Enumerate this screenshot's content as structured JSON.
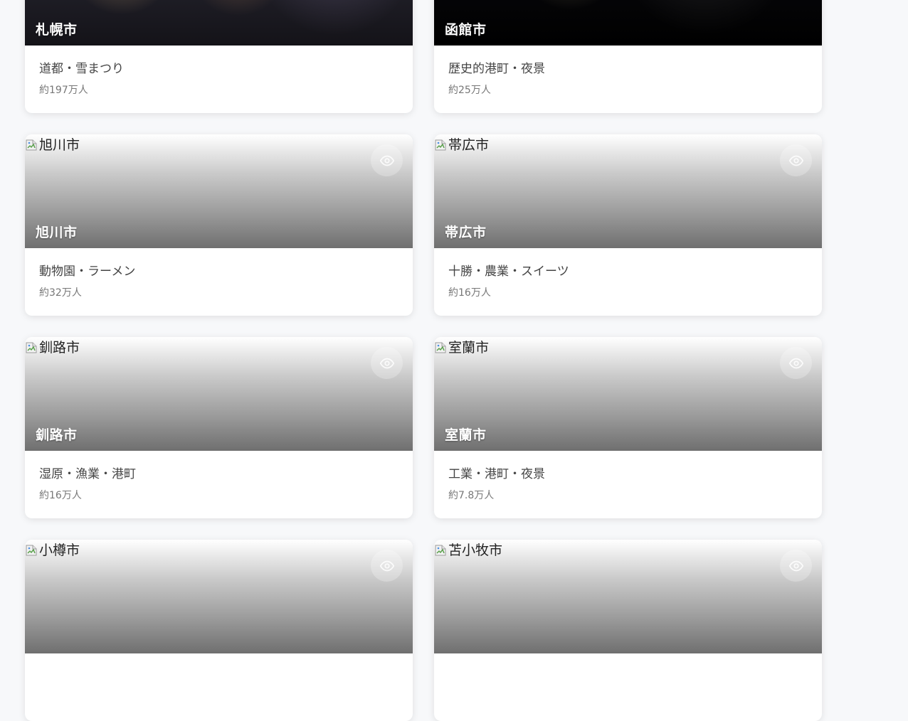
{
  "cards": [
    {
      "city": "札幌市",
      "alt": "札幌市",
      "tags": "道都・雪まつり",
      "population": "約197万人"
    },
    {
      "city": "函館市",
      "alt": "函館市",
      "tags": "歴史的港町・夜景",
      "population": "約25万人"
    },
    {
      "city": "旭川市",
      "alt": "旭川市",
      "tags": "動物園・ラーメン",
      "population": "約32万人"
    },
    {
      "city": "帯広市",
      "alt": "帯広市",
      "tags": "十勝・農業・スイーツ",
      "population": "約16万人"
    },
    {
      "city": "釧路市",
      "alt": "釧路市",
      "tags": "湿原・漁業・港町",
      "population": "約16万人"
    },
    {
      "city": "室蘭市",
      "alt": "室蘭市",
      "tags": "工業・港町・夜景",
      "population": "約7.8万人"
    },
    {
      "city": "小樽市",
      "alt": "小樽市"
    },
    {
      "city": "苫小牧市",
      "alt": "苫小牧市"
    }
  ]
}
